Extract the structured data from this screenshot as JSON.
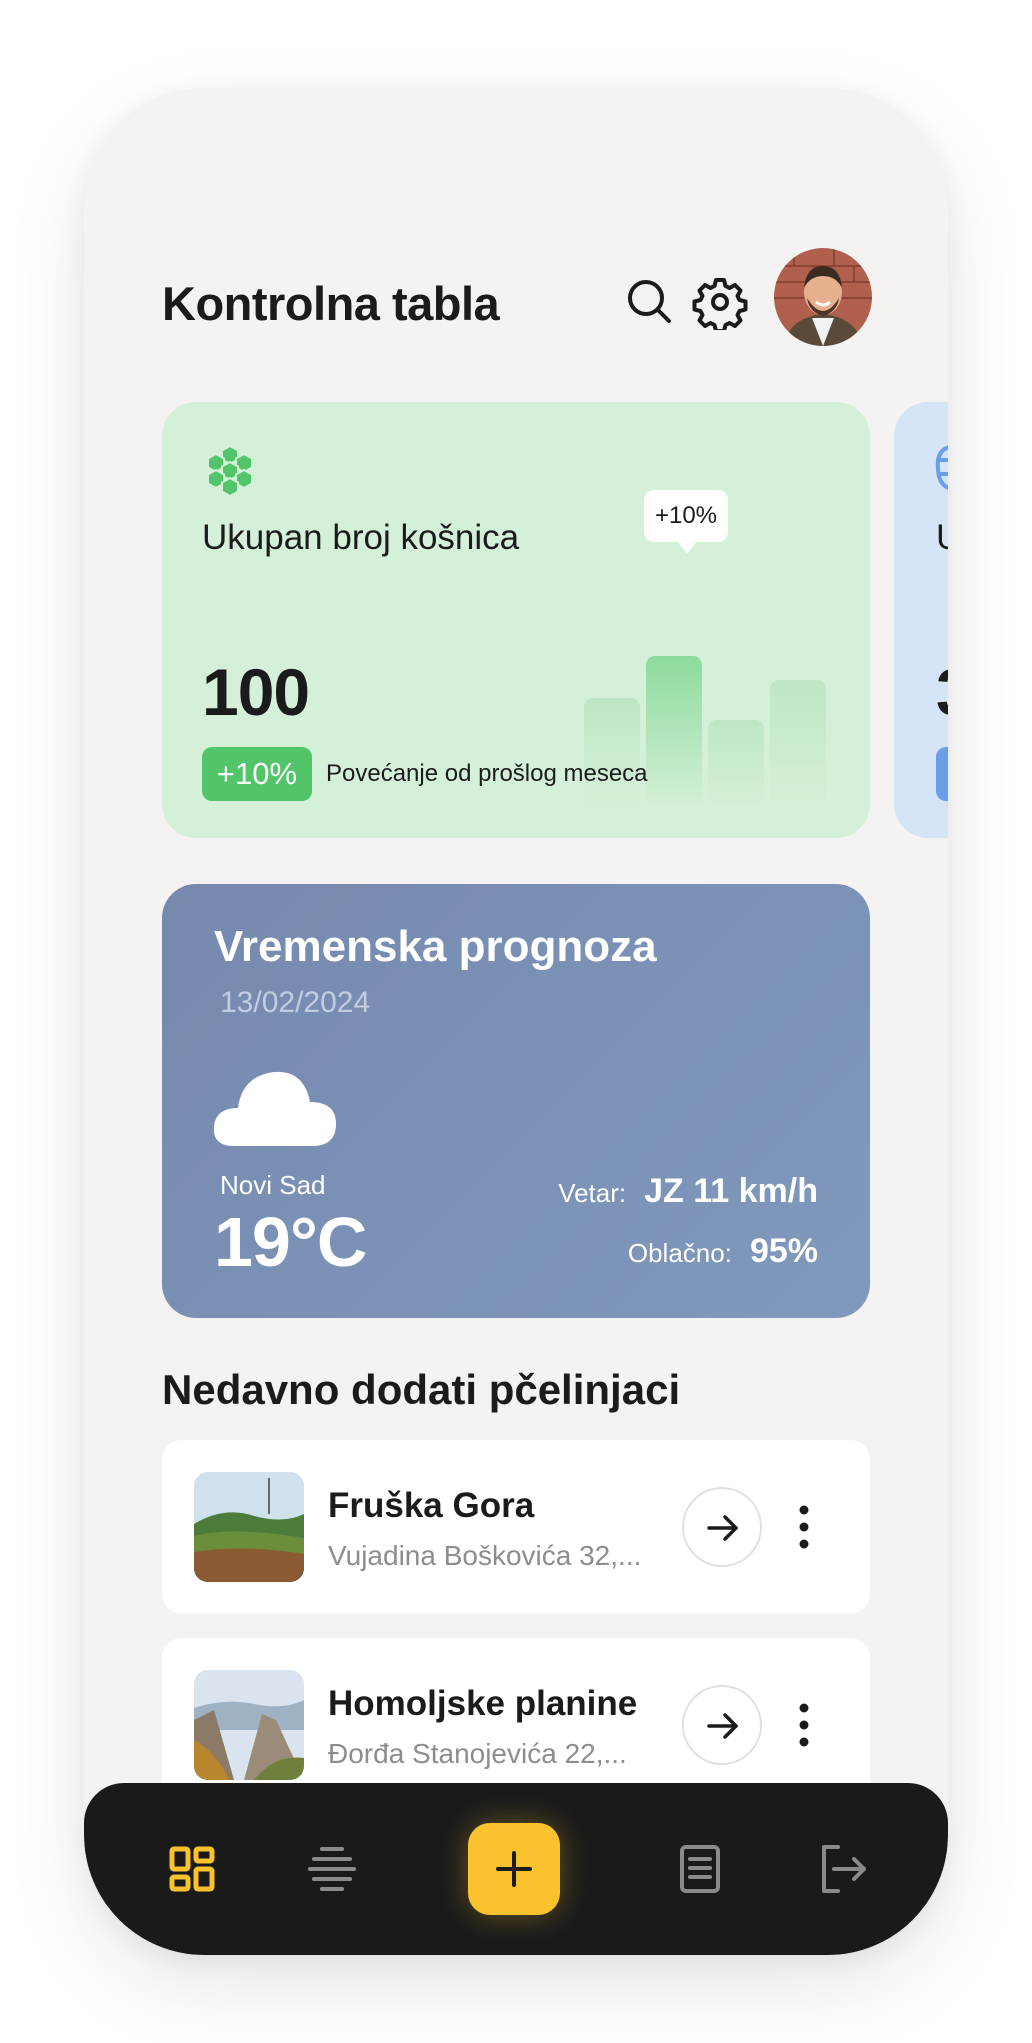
{
  "header": {
    "title": "Kontrolna tabla"
  },
  "stats_card": {
    "label": "Ukupan broj košnica",
    "value": "100",
    "trend_badge": "+10%",
    "trend_text": "Povećanje od prošlog meseca",
    "chart_tooltip": "+10%",
    "accent_color": "#52c56a"
  },
  "peek_card": {
    "label": "U",
    "value": "3"
  },
  "weather": {
    "title": "Vremenska prognoza",
    "date": "13/02/2024",
    "city": "Novi Sad",
    "temperature": "19°C",
    "wind_label": "Vetar:",
    "wind_value": "JZ 11 km/h",
    "cloudy_label": "Oblačno:",
    "cloudy_value": "95%"
  },
  "recent": {
    "title": "Nedavno dodati pčelinjaci",
    "items": [
      {
        "name": "Fruška Gora",
        "address": "Vujadina Boškovića 32,..."
      },
      {
        "name": "Homoljske planine",
        "address": "Đorđa Stanojevića 22,..."
      }
    ]
  },
  "nav": {
    "items": [
      "dashboard-icon",
      "hives-icon",
      "add-icon",
      "reports-icon",
      "logout-icon"
    ],
    "active_color": "#fbc230"
  }
}
